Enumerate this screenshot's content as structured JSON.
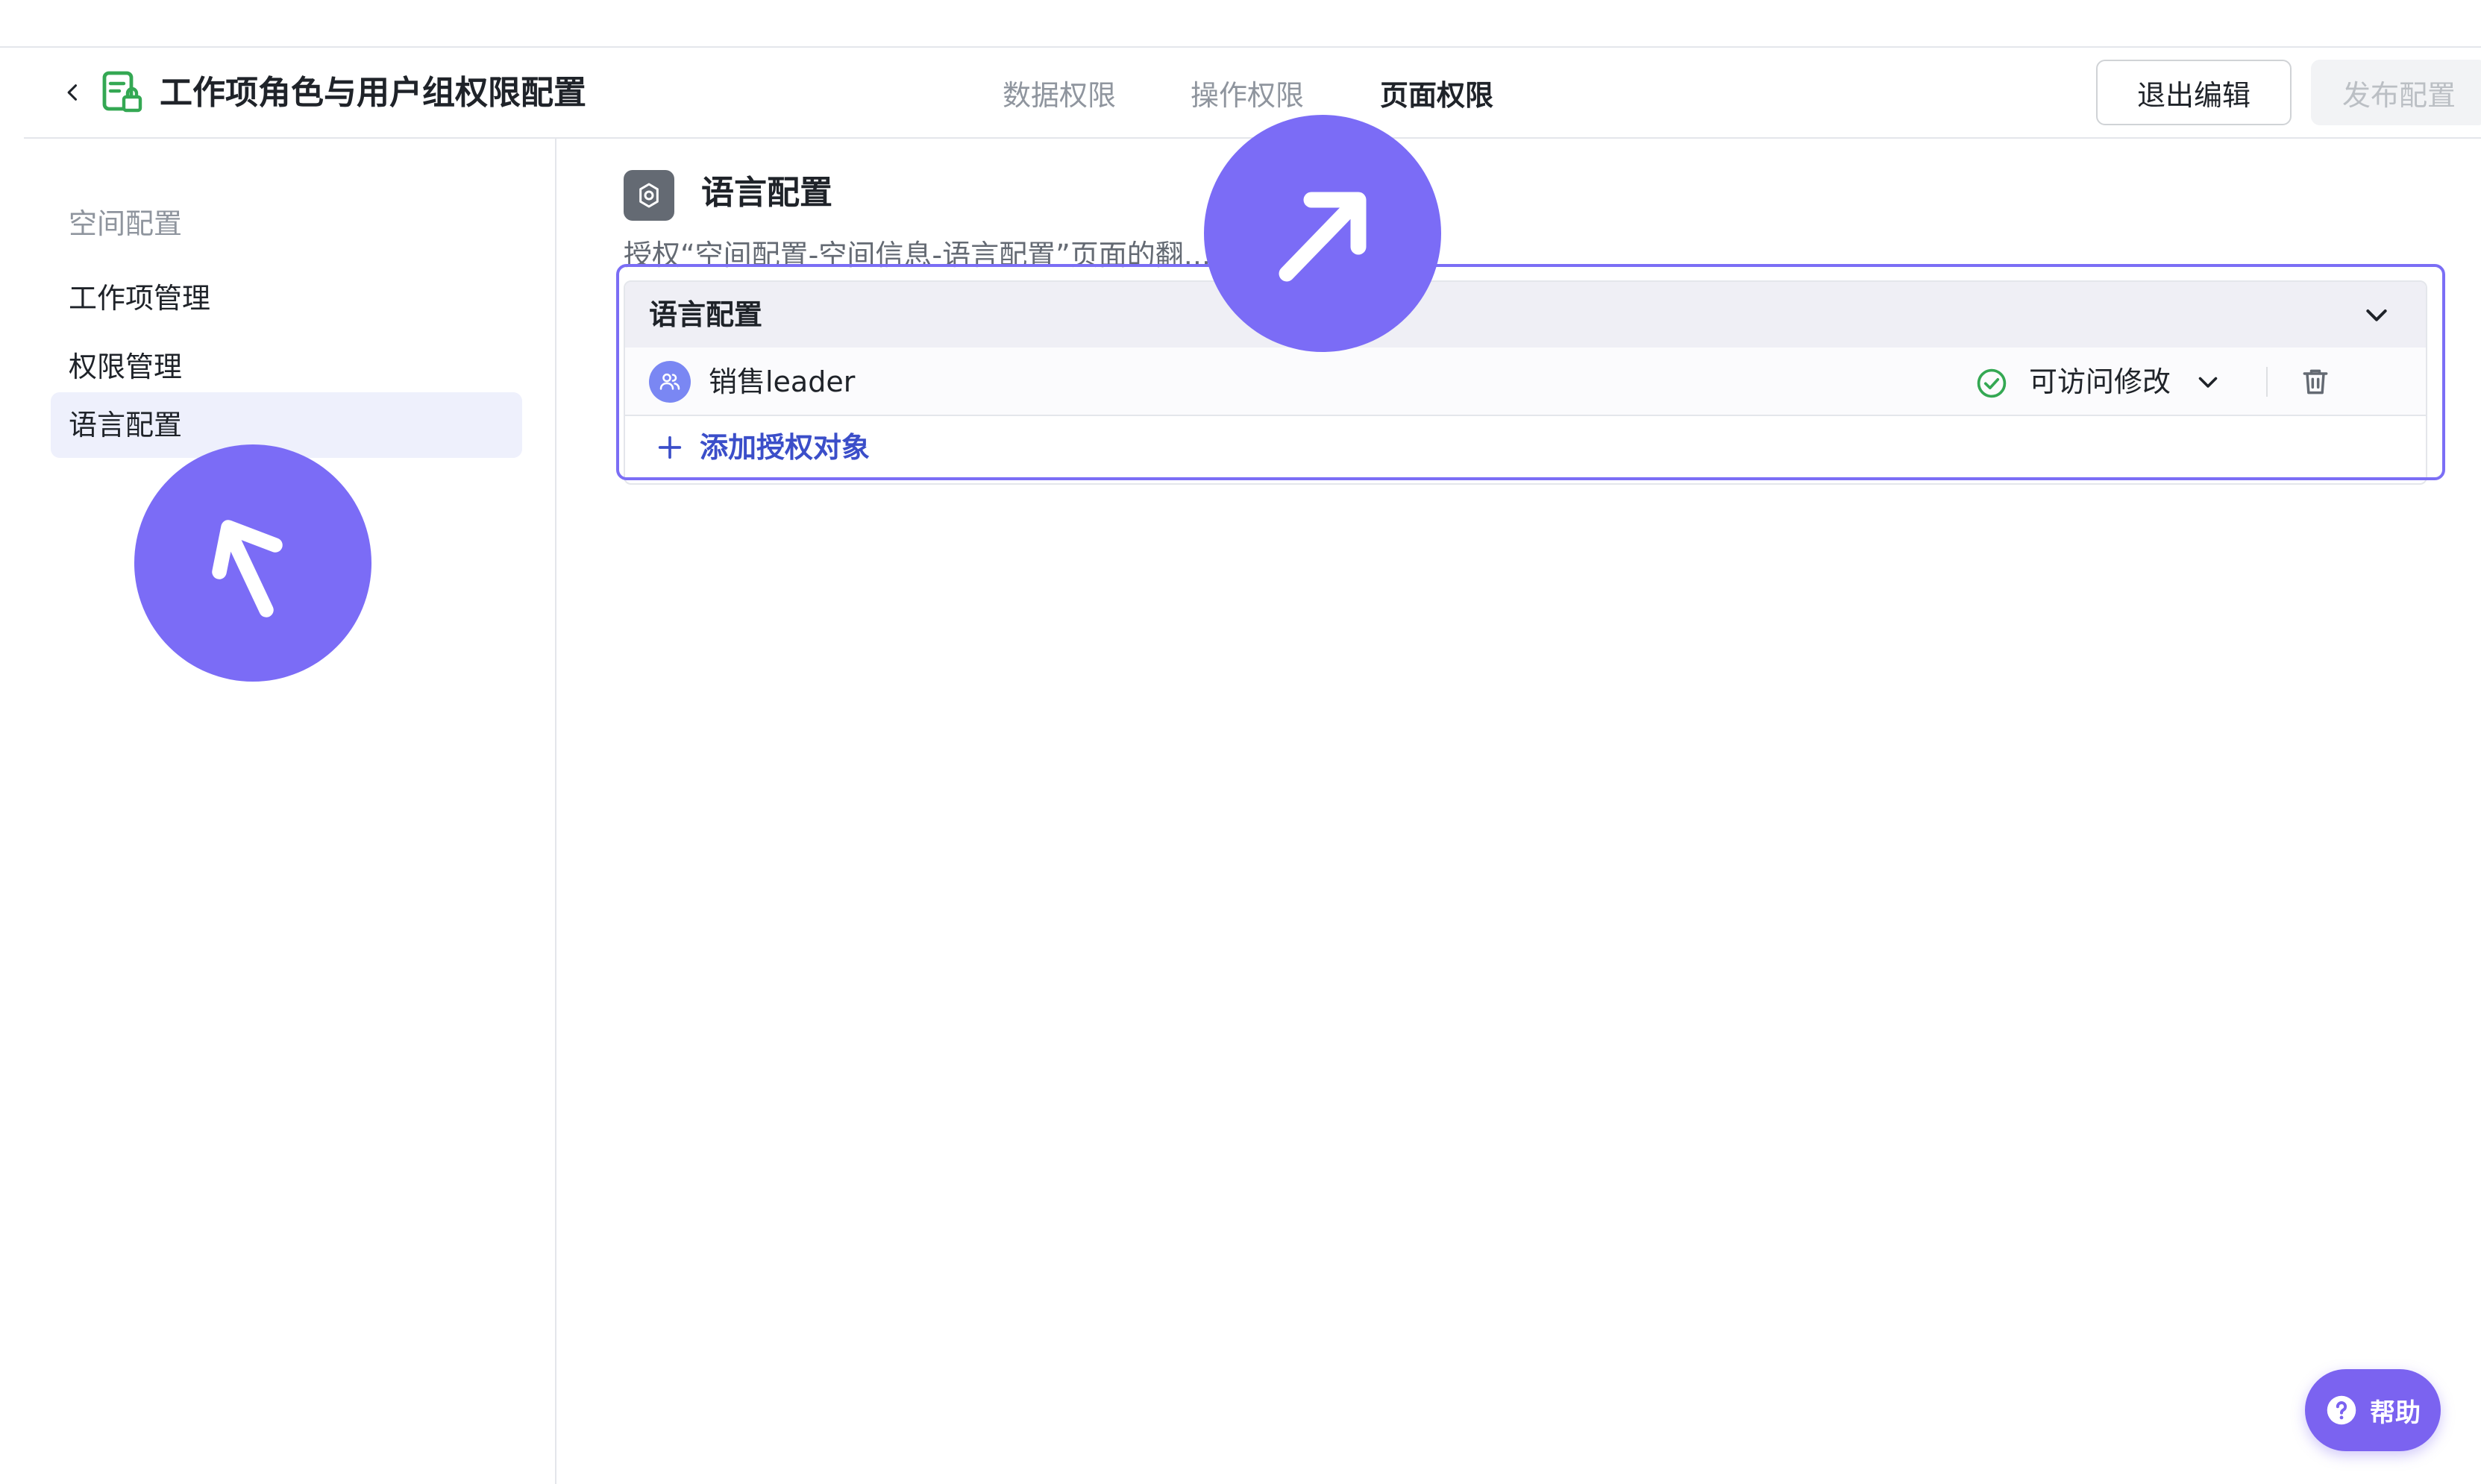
{
  "header": {
    "title": "工作项角色与用户组权限配置",
    "tabs": [
      {
        "label": "数据权限",
        "active": false
      },
      {
        "label": "操作权限",
        "active": false
      },
      {
        "label": "页面权限",
        "active": true
      }
    ],
    "exit_edit_label": "退出编辑",
    "publish_label": "发布配置"
  },
  "sidebar": {
    "group_label": "空间配置",
    "items": [
      {
        "label": "工作项管理",
        "selected": false
      },
      {
        "label": "权限管理",
        "selected": false
      },
      {
        "label": "语言配置",
        "selected": true
      }
    ]
  },
  "section": {
    "title": "语言配置",
    "description": "授权“空间配置-空间信息-语言配置”页面的翻...成员",
    "card": {
      "header_label": "语言配置",
      "rows": [
        {
          "name": "销售leader",
          "permission": "可访问修改"
        }
      ],
      "add_label": "添加授权对象"
    }
  },
  "help": {
    "label": "帮助"
  },
  "colors": {
    "accent": "#3b4ec9",
    "marker": "#7b6cf6",
    "selected_bg": "#eef0fc",
    "success": "#34a853",
    "doc_icon": "#34a853"
  },
  "icons": [
    "chevron-left-icon",
    "doc-lock-icon",
    "gear-icon",
    "chevron-down-icon",
    "user-group-icon",
    "check-circle-icon",
    "trash-icon",
    "plus-icon",
    "arrow-up-right-icon",
    "arrow-up-left-icon",
    "question-icon"
  ]
}
